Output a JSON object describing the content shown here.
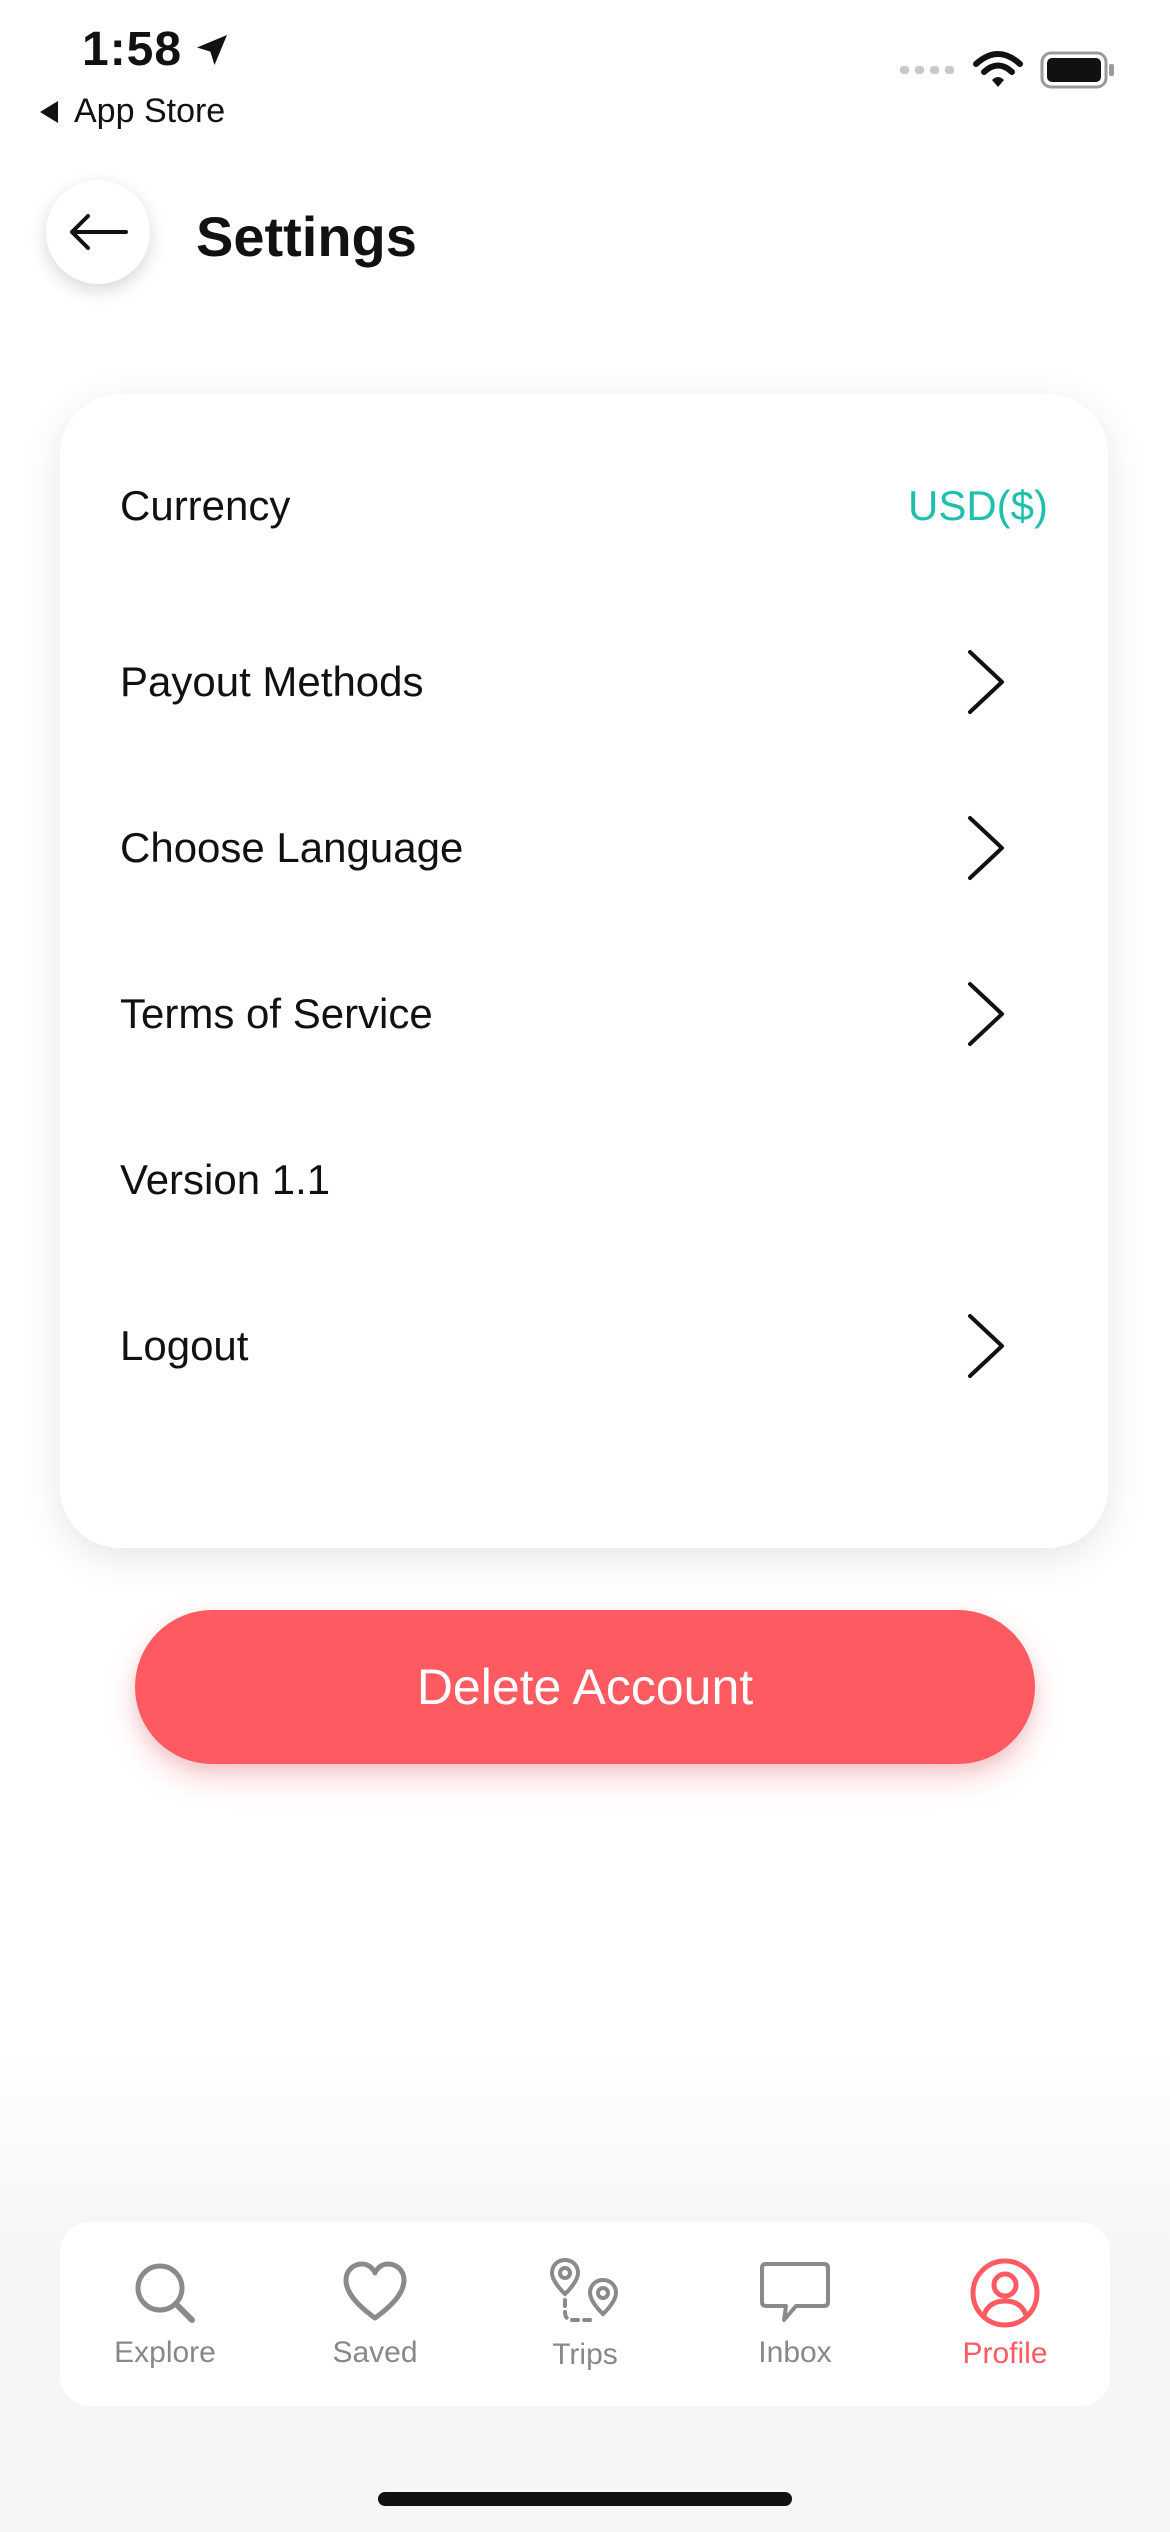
{
  "status_bar": {
    "time": "1:58",
    "back_app": "App Store"
  },
  "header": {
    "title": "Settings"
  },
  "settings": {
    "rows": [
      {
        "label": "Currency",
        "value": "USD($)"
      },
      {
        "label": "Payout Methods"
      },
      {
        "label": "Choose Language"
      },
      {
        "label": "Terms of Service"
      },
      {
        "label": "Version 1.1"
      },
      {
        "label": "Logout"
      }
    ]
  },
  "delete_button": {
    "label": "Delete Account"
  },
  "tabs": [
    {
      "label": "Explore",
      "icon": "search-icon",
      "active": false
    },
    {
      "label": "Saved",
      "icon": "heart-icon",
      "active": false
    },
    {
      "label": "Trips",
      "icon": "trips-icon",
      "active": false
    },
    {
      "label": "Inbox",
      "icon": "chat-icon",
      "active": false
    },
    {
      "label": "Profile",
      "icon": "profile-icon",
      "active": true
    }
  ],
  "colors": {
    "accent": "#fd5a62",
    "currency_value": "#1fbfae",
    "inactive_tab": "#888888"
  }
}
